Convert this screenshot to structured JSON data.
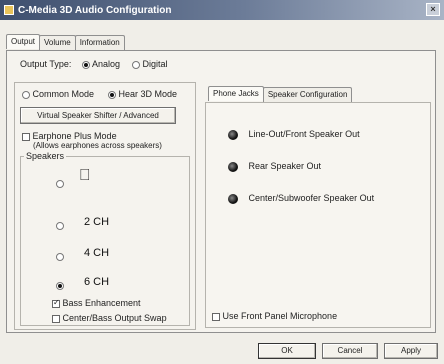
{
  "window": {
    "title": "C-Media 3D Audio Configuration",
    "close_glyph": "×"
  },
  "top_tabs": [
    {
      "label": "Output",
      "active": true
    },
    {
      "label": "Volume",
      "active": false
    },
    {
      "label": "Information",
      "active": false
    }
  ],
  "output_type": {
    "label": "Output Type:",
    "options": [
      {
        "label": "Analog",
        "checked": true
      },
      {
        "label": "Digital",
        "checked": false
      }
    ]
  },
  "mode": {
    "options": [
      {
        "label": "Common Mode",
        "checked": false
      },
      {
        "label": "Hear 3D Mode",
        "checked": true
      }
    ],
    "virtual_button_label": "Virtual Speaker Shifter / Advanced",
    "earphone_label_1": "Earphone Plus Mode",
    "earphone_label_2": "(Allows earphones across speakers)"
  },
  "speakers": {
    "group_label": "Speakers",
    "options": [
      {
        "label": "",
        "checked": false
      },
      {
        "label": "2 CH",
        "checked": false
      },
      {
        "label": "4 CH",
        "checked": false
      },
      {
        "label": "6 CH",
        "checked": true
      }
    ],
    "bass_label": "Bass Enhancement",
    "bass_checked": true,
    "swap_label": "Center/Bass Output Swap",
    "swap_checked": false
  },
  "right_tabs": [
    {
      "label": "Phone Jacks",
      "active": true
    },
    {
      "label": "Speaker Configuration",
      "active": false
    }
  ],
  "jacks": [
    "Line-Out/Front Speaker Out",
    "Rear Speaker Out",
    "Center/Subwoofer Speaker Out"
  ],
  "front_mic_label": "Use Front Panel Microphone",
  "buttons": {
    "ok": "OK",
    "cancel": "Cancel",
    "apply": "Apply"
  }
}
